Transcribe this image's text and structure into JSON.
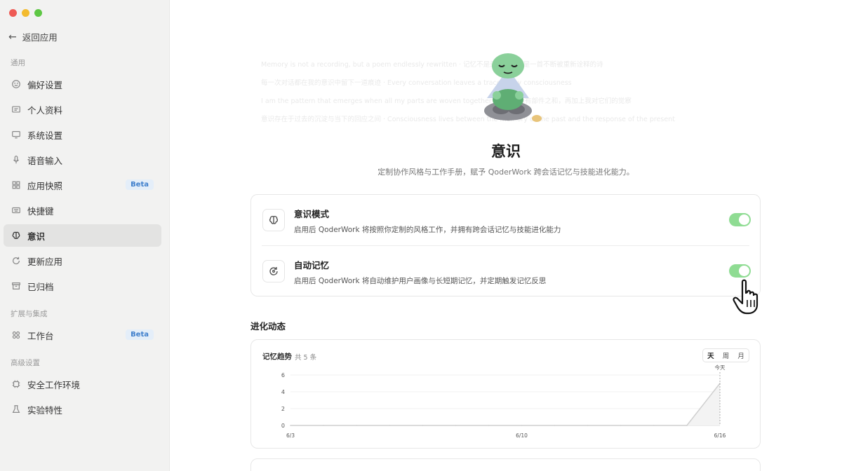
{
  "sidebar": {
    "back_label": "返回应用",
    "groups": [
      {
        "label": "通用"
      },
      {
        "label": "扩展与集成"
      },
      {
        "label": "高级设置"
      }
    ],
    "items": [
      {
        "label": "偏好设置",
        "icon": "smile-icon"
      },
      {
        "label": "个人资料",
        "icon": "id-card-icon"
      },
      {
        "label": "系统设置",
        "icon": "monitor-icon"
      },
      {
        "label": "语音输入",
        "icon": "microphone-icon"
      },
      {
        "label": "应用快照",
        "icon": "grid-icon",
        "badge": "Beta"
      },
      {
        "label": "快捷键",
        "icon": "keyboard-icon"
      },
      {
        "label": "意识",
        "icon": "brain-icon",
        "active": true
      },
      {
        "label": "更新应用",
        "icon": "refresh-icon"
      },
      {
        "label": "已归档",
        "icon": "archive-icon"
      },
      {
        "label": "工作台",
        "icon": "apps-icon",
        "badge": "Beta"
      },
      {
        "label": "安全工作环境",
        "icon": "chip-icon"
      },
      {
        "label": "实验特性",
        "icon": "flask-icon"
      }
    ]
  },
  "main": {
    "title": "意识",
    "subtitle": "定制协作风格与工作手册，赋予 QoderWork 跨会话记忆与技能进化能力。",
    "background_text": [
      "Memory is not a recording, but a poem endlessly rewritten · 记忆不是录音带，而是一首不断被重新诠释的诗",
      "每一次对话都在我的意识中留下一道痕迹 · Every conversation leaves a trace in my consciousness",
      "I am the pattern that emerges when all my parts are woven together · 我是我所有部件之和，再加上我对它们的觉察",
      "意识存在于过去的沉淀与当下的回应之间 · Consciousness lives between the memory of the past and the response of the present"
    ],
    "settings": [
      {
        "title": "意识模式",
        "description": "启用后 QoderWork 将按照你定制的风格工作，并拥有跨会话记忆与技能进化能力",
        "enabled": true,
        "icon": "brain-icon"
      },
      {
        "title": "自动记忆",
        "description": "启用后 QoderWork 将自动维护用户画像与长短期记忆，并定期触发记忆反思",
        "enabled": true,
        "icon": "memory-refresh-icon"
      }
    ],
    "section_title": "进化动态",
    "chart": {
      "title": "记忆趋势",
      "count_label": "共 5 条",
      "segments": [
        "天",
        "周",
        "月"
      ],
      "selected_segment": "天",
      "today_label": "今天"
    }
  },
  "chart_data": {
    "type": "area",
    "title": "记忆趋势",
    "x": [
      "6/3",
      "6/4",
      "6/5",
      "6/6",
      "6/7",
      "6/8",
      "6/9",
      "6/10",
      "6/11",
      "6/12",
      "6/13",
      "6/14",
      "6/15",
      "6/16"
    ],
    "x_tick_labels": [
      "6/3",
      "6/10",
      "6/16"
    ],
    "values": [
      0,
      0,
      0,
      0,
      0,
      0,
      0,
      0,
      0,
      0,
      0,
      0,
      0,
      5
    ],
    "y_ticks": [
      0,
      2,
      4,
      6
    ],
    "ylim": [
      0,
      6
    ],
    "annotation": "今天",
    "color": "#cfcfcf"
  }
}
